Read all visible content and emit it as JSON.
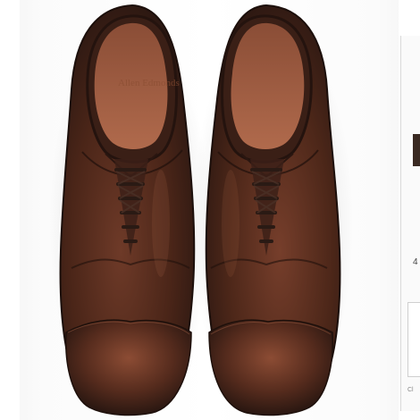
{
  "photo": {
    "subject": "pair-of-oxford-shoes",
    "insole_brand": "Allen Edmonds",
    "colors": {
      "leather_dark": "#2e1a14",
      "leather_mid": "#5a2f22",
      "leather_light": "#7a4130",
      "lining": "#9a5a40",
      "background": "#ffffff"
    }
  },
  "side_panel": {
    "glyph_a": "4",
    "tiny_text": "Cl"
  }
}
